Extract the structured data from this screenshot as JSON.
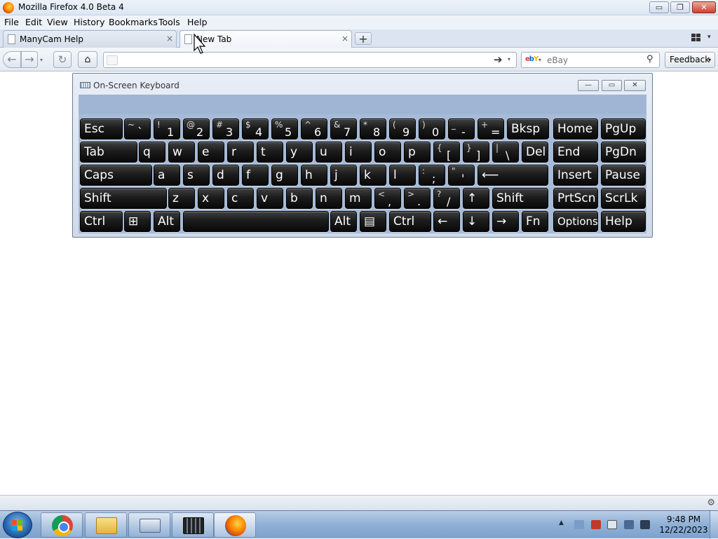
{
  "window": {
    "title": "Mozilla Firefox 4.0 Beta 4",
    "controls": {
      "minimize": "▭",
      "maximize": "❐",
      "close": "✕"
    }
  },
  "menu": [
    "File",
    "Edit",
    "View",
    "History",
    "Bookmarks",
    "Tools",
    "Help"
  ],
  "tabs": [
    {
      "label": "ManyCam Help",
      "close": "×"
    },
    {
      "label": "New Tab",
      "close": "×"
    }
  ],
  "new_tab_symbol": "+",
  "nav": {
    "back": "←",
    "forward": "→",
    "reload": "↻",
    "home": "⌂",
    "go": "➔",
    "dropdown": "▾",
    "url": "",
    "search_engine": "ebY",
    "search_placeholder": "eBay",
    "search_icon": "⚲",
    "feedback_label": "Feedback",
    "feedback_arrow": "▾"
  },
  "osk": {
    "title": "On-Screen Keyboard",
    "controls": {
      "minimize": "—",
      "maximize": "▭",
      "close": "✕"
    },
    "rows": [
      [
        {
          "lab": "Esc"
        },
        {
          "sec": "~",
          "pri": "`"
        },
        {
          "sec": "!",
          "pri": "1"
        },
        {
          "sec": "@",
          "pri": "2"
        },
        {
          "sec": "#",
          "pri": "3"
        },
        {
          "sec": "$",
          "pri": "4"
        },
        {
          "sec": "%",
          "pri": "5"
        },
        {
          "sec": "^",
          "pri": "6"
        },
        {
          "sec": "&",
          "pri": "7"
        },
        {
          "sec": "*",
          "pri": "8"
        },
        {
          "sec": "(",
          "pri": "9"
        },
        {
          "sec": ")",
          "pri": "0"
        },
        {
          "sec": "_",
          "pri": "-"
        },
        {
          "sec": "+",
          "pri": "="
        },
        {
          "lab": "Bksp"
        },
        {
          "lab": "Home"
        },
        {
          "lab": "PgUp"
        }
      ],
      [
        {
          "lab": "Tab"
        },
        {
          "lab": "q"
        },
        {
          "lab": "w"
        },
        {
          "lab": "e"
        },
        {
          "lab": "r"
        },
        {
          "lab": "t"
        },
        {
          "lab": "y"
        },
        {
          "lab": "u"
        },
        {
          "lab": "i"
        },
        {
          "lab": "o"
        },
        {
          "lab": "p"
        },
        {
          "sec": "{",
          "pri": "["
        },
        {
          "sec": "}",
          "pri": "]"
        },
        {
          "sec": "|",
          "pri": "\\"
        },
        {
          "lab": "Del"
        },
        {
          "lab": "End"
        },
        {
          "lab": "PgDn"
        }
      ],
      [
        {
          "lab": "Caps"
        },
        {
          "lab": "a"
        },
        {
          "lab": "s"
        },
        {
          "lab": "d"
        },
        {
          "lab": "f"
        },
        {
          "lab": "g"
        },
        {
          "lab": "h"
        },
        {
          "lab": "j"
        },
        {
          "lab": "k"
        },
        {
          "lab": "l"
        },
        {
          "sec": ":",
          "pri": ";"
        },
        {
          "sec": "\"",
          "pri": "'"
        },
        {
          "lab": "⟵"
        },
        {
          "lab": "Insert"
        },
        {
          "lab": "Pause"
        }
      ],
      [
        {
          "lab": "Shift"
        },
        {
          "lab": "z"
        },
        {
          "lab": "x"
        },
        {
          "lab": "c"
        },
        {
          "lab": "v"
        },
        {
          "lab": "b"
        },
        {
          "lab": "n"
        },
        {
          "lab": "m"
        },
        {
          "sec": "<",
          "pri": ","
        },
        {
          "sec": ">",
          "pri": "."
        },
        {
          "sec": "?",
          "pri": "/"
        },
        {
          "lab": "↑"
        },
        {
          "lab": "Shift"
        },
        {
          "lab": "PrtScn"
        },
        {
          "lab": "ScrLk"
        }
      ],
      [
        {
          "lab": "Ctrl"
        },
        {
          "lab": "⊞"
        },
        {
          "lab": "Alt"
        },
        {
          "lab": ""
        },
        {
          "lab": "Alt"
        },
        {
          "lab": "▤"
        },
        {
          "lab": "Ctrl"
        },
        {
          "lab": "←"
        },
        {
          "lab": "↓"
        },
        {
          "lab": "→"
        },
        {
          "lab": "Fn"
        },
        {
          "lab": "Options"
        },
        {
          "lab": "Help"
        }
      ]
    ]
  },
  "taskbar": {
    "apps": [
      "Google Chrome",
      "Windows Explorer",
      "On-Screen Keyboard",
      "Windows Live Movie Maker",
      "Mozilla Firefox"
    ],
    "tray_up": "▲",
    "time": "9:48 PM",
    "date": "12/22/2023"
  },
  "colors": {
    "osk_body": "#a7bbd7",
    "key_face": "#1c1c1c",
    "taskbar": "#8fb0d6",
    "active_tab": "#fdfdfe"
  }
}
